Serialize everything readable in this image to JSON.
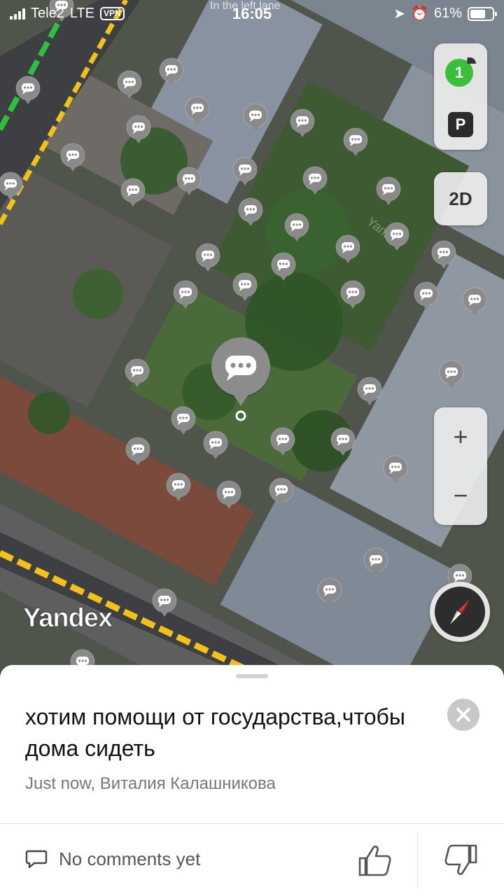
{
  "status_bar": {
    "carrier": "Tele2",
    "network": "LTE",
    "vpn_label": "VPN",
    "time": "16:05",
    "battery": "61%",
    "street_label": "In the left lane"
  },
  "map": {
    "traffic_level": "1",
    "parking_label": "P",
    "mode_label": "2D",
    "zoom_in_label": "+",
    "zoom_out_label": "−",
    "logo": "Yandex",
    "watermark": "Yandex"
  },
  "comment": {
    "text": "хотим помощи от государства,чтобы дома сидеть",
    "meta": "Just now, Виталия Калашникова",
    "comments_label": "No comments yet"
  },
  "colors": {
    "accent_green": "#3bbf3b",
    "road_yellow": "#f2c21b",
    "marker_gray": "#8a8a8a"
  }
}
